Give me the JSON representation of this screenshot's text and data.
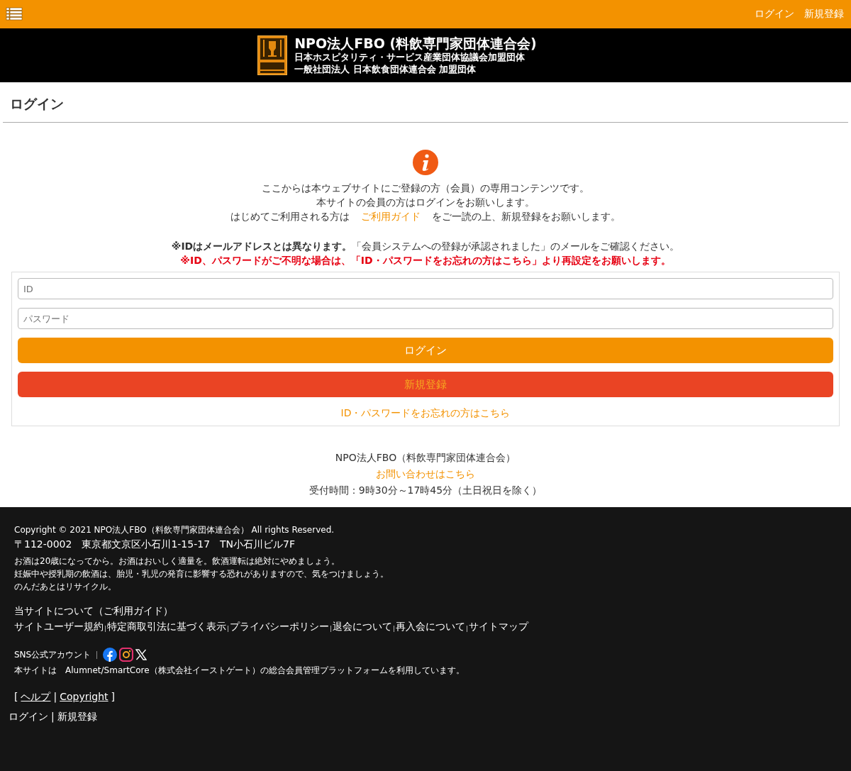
{
  "top_bar": {
    "links": [
      "ログイン",
      "新規登録"
    ]
  },
  "header": {
    "title": "NPO法人FBO (料飲専門家団体連合会)",
    "subtitles": [
      "日本ホスピタリティ・サービス産業団体協議会加盟団体",
      "一般社団法人 日本飲食団体連合会 加盟団体"
    ]
  },
  "page_title": "ログイン",
  "notice": {
    "lines": [
      "ここからは本ウェブサイトにご登録の方（会員）の専用コンテンツです。",
      "本サイトの会員の方はログインをお願いします。"
    ],
    "guide_before": "はじめてご利用される方は",
    "guide_link": "ご利用ガイド",
    "guide_after": "をご一読の上、新規登録をお願いします。",
    "warnings": [
      "**※IDはメールアドレスとは異なります。**「会員システムへの登録が承認されました」のメールをご確認ください。",
      "※ID、パスワードがご不明な場合は、「ID・パスワードをお忘れの方はこちら」より再設定をお願いします。"
    ]
  },
  "form": {
    "id_placeholder": "ID",
    "password_placeholder": "パスワード",
    "login_button": "ログイン",
    "register_button": "新規登録",
    "forgot_link": "ID・パスワードをお忘れの方はこちら"
  },
  "contact": {
    "organization": "NPO法人FBO（料飲専門家団体連合会）",
    "link": "お問い合わせはこちら",
    "hours": "受付時間：9時30分～17時45分（土日祝日を除く）"
  },
  "footer": {
    "copyright": "Copyright © 2021 NPO法人FBO（料飲専門家団体連合会） All rights Reserved.",
    "address": "〒112-0002　東京都文京区小石川1-15-17　TN小石川ビル7F",
    "notes": [
      "お酒は20歳になってから。お酒はおいしく適量を。飲酒運転は絶対にやめましょう。",
      "妊娠中や授乳期の飲酒は、胎児・乳児の発育に影響する恐れがありますので、気をつけましょう。",
      "のんだあとはリサイクル。"
    ],
    "about_title": "当サイトについて（ご利用ガイド）",
    "links": [
      "サイトユーザー規約",
      "特定商取引法に基づく表示",
      "プライバシーポリシー",
      "退会について",
      "再入会について",
      "サイトマップ"
    ],
    "sns_label": "SNS公式アカウント",
    "platform_note": "本サイトは　Alumnet/SmartCore（株式会社イーストゲート）の総合会員管理プラットフォームを利用しています。",
    "help_open": "[",
    "help_links": [
      "ヘルプ",
      "Copyright"
    ],
    "help_separator": "|",
    "help_close": "]",
    "bottom_separator": "|",
    "bottom_links": [
      "ログイン",
      "新規登録"
    ]
  }
}
